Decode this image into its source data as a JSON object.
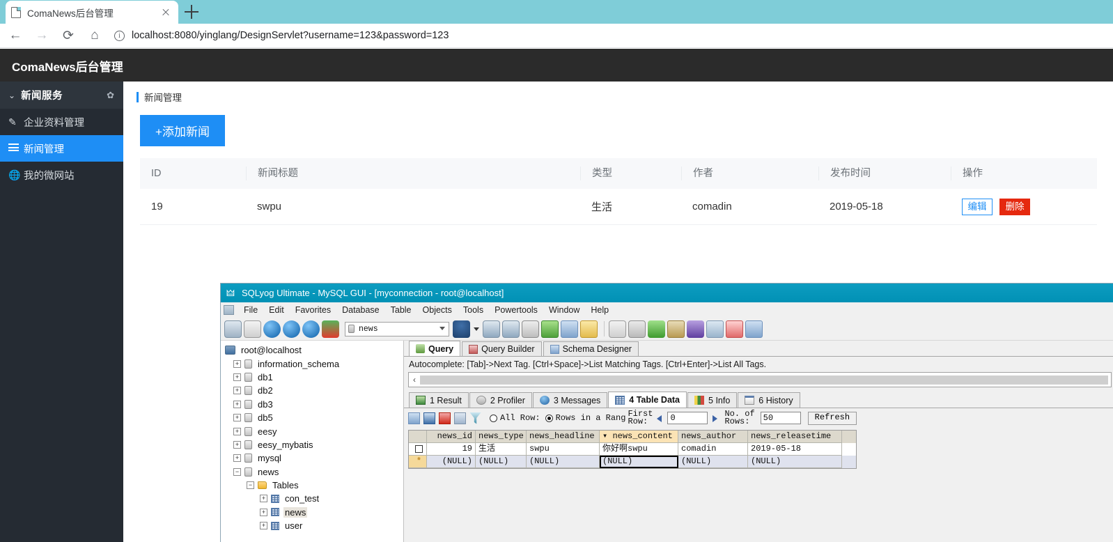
{
  "browser": {
    "tab_title": "ComaNews后台管理",
    "tab_favicon": "page-icon",
    "new_tab": "+",
    "back": "←",
    "forward": "→",
    "reload": "⟳",
    "home": "⌂",
    "url_info_icon": "ⓘ",
    "url": "localhost:8080/yinglang/DesignServlet?username=123&password=123"
  },
  "app": {
    "brand": "ComaNews后台管理",
    "sidebar": {
      "group": {
        "label": "新闻服务",
        "chevron": "⌄",
        "gear": "✿"
      },
      "items": [
        {
          "label": "企业资料管理",
          "icon": "pencil-icon",
          "glyph": "✎",
          "active": false
        },
        {
          "label": "新闻管理",
          "icon": "hamburger-icon",
          "glyph": "",
          "active": true
        },
        {
          "label": "我的微网站",
          "icon": "globe-icon",
          "glyph": "🌐",
          "active": false
        }
      ]
    },
    "breadcrumb": "新闻管理",
    "add_button": "+添加新闻",
    "table": {
      "columns": [
        "ID",
        "新闻标题",
        "类型",
        "作者",
        "发布时间",
        "操作"
      ],
      "rows": [
        {
          "id": "19",
          "title": "swpu",
          "type": "生活",
          "author": "comadin",
          "time": "2019-05-18",
          "edit": "编辑",
          "delete": "删除"
        }
      ]
    },
    "colors": {
      "accent": "#1e8ef5",
      "danger": "#e5290f",
      "sidebar": "#252b33",
      "brandbar": "#2b2b2b"
    }
  },
  "sqlyog": {
    "title": "SQLyog Ultimate - MySQL GUI - [myconnection - root@localhost]",
    "menu": [
      "File",
      "Edit",
      "Favorites",
      "Database",
      "Table",
      "Objects",
      "Tools",
      "Powertools",
      "Window",
      "Help"
    ],
    "toolbar": {
      "db_selected": "news"
    },
    "tree": [
      {
        "label": "root@localhost",
        "indent": 0,
        "icon": "server-icon",
        "expander": "",
        "selected": false
      },
      {
        "label": "information_schema",
        "indent": 1,
        "icon": "db-icon",
        "expander": "+",
        "selected": false
      },
      {
        "label": "db1",
        "indent": 1,
        "icon": "db-icon",
        "expander": "+",
        "selected": false
      },
      {
        "label": "db2",
        "indent": 1,
        "icon": "db-icon",
        "expander": "+",
        "selected": false
      },
      {
        "label": "db3",
        "indent": 1,
        "icon": "db-icon",
        "expander": "+",
        "selected": false
      },
      {
        "label": "db5",
        "indent": 1,
        "icon": "db-icon",
        "expander": "+",
        "selected": false
      },
      {
        "label": "eesy",
        "indent": 1,
        "icon": "db-icon",
        "expander": "+",
        "selected": false
      },
      {
        "label": "eesy_mybatis",
        "indent": 1,
        "icon": "db-icon",
        "expander": "+",
        "selected": false
      },
      {
        "label": "mysql",
        "indent": 1,
        "icon": "db-icon",
        "expander": "+",
        "selected": false
      },
      {
        "label": "news",
        "indent": 1,
        "icon": "db-icon",
        "expander": "−",
        "selected": false
      },
      {
        "label": "Tables",
        "indent": 2,
        "icon": "folder-icon",
        "expander": "−",
        "selected": false
      },
      {
        "label": "con_test",
        "indent": 3,
        "icon": "table-icon",
        "expander": "+",
        "selected": false
      },
      {
        "label": "news",
        "indent": 3,
        "icon": "table-icon",
        "expander": "+",
        "selected": true
      },
      {
        "label": "user",
        "indent": 3,
        "icon": "table-icon",
        "expander": "+",
        "selected": false
      }
    ],
    "query_tabs": [
      {
        "label": "Query",
        "icon": "query-icon",
        "active": true
      },
      {
        "label": "Query Builder",
        "icon": "query-builder-icon",
        "active": false
      },
      {
        "label": "Schema Designer",
        "icon": "schema-designer-icon",
        "active": false
      }
    ],
    "autocomplete_hint": "Autocomplete: [Tab]->Next Tag. [Ctrl+Space]->List Matching Tags. [Ctrl+Enter]->List All Tags.",
    "editor_scroll_glyph": "‹",
    "result_tabs": [
      {
        "label": "1 Result",
        "icon": "result-icon",
        "active": false
      },
      {
        "label": "2 Profiler",
        "icon": "profiler-icon",
        "active": false
      },
      {
        "label": "3 Messages",
        "icon": "messages-icon",
        "active": false
      },
      {
        "label": "4 Table Data",
        "icon": "table-data-icon",
        "active": true
      },
      {
        "label": "5 Info",
        "icon": "info-icon",
        "active": false
      },
      {
        "label": "6 History",
        "icon": "history-icon",
        "active": false
      }
    ],
    "rowbar": {
      "all_row_label": "All Row:",
      "all_row_selected": false,
      "range_label": "Rows in a Rang",
      "range_selected": true,
      "first_row_label_1": "First",
      "first_row_label_2": "Row:",
      "first_row_value": "0",
      "no_of_label_1": "No. of",
      "no_of_label_2": "Rows:",
      "no_of_value": "50",
      "refresh": "Refresh"
    },
    "grid": {
      "columns": [
        "news_id",
        "news_type",
        "news_headline",
        "news_content",
        "news_author",
        "news_releasetime"
      ],
      "sort_column": "news_content",
      "sort_glyph": "▾",
      "rows": [
        {
          "marker": "checkbox",
          "cells": [
            "19",
            "生活",
            "swpu",
            "你好啊swpu",
            "comadin",
            "2019-05-18"
          ],
          "selected": false
        },
        {
          "marker": "star",
          "cells": [
            "(NULL)",
            "(NULL)",
            "(NULL)",
            "(NULL)",
            "(NULL)",
            "(NULL)"
          ],
          "selected": true
        }
      ],
      "focused_cell": "news_content"
    }
  }
}
